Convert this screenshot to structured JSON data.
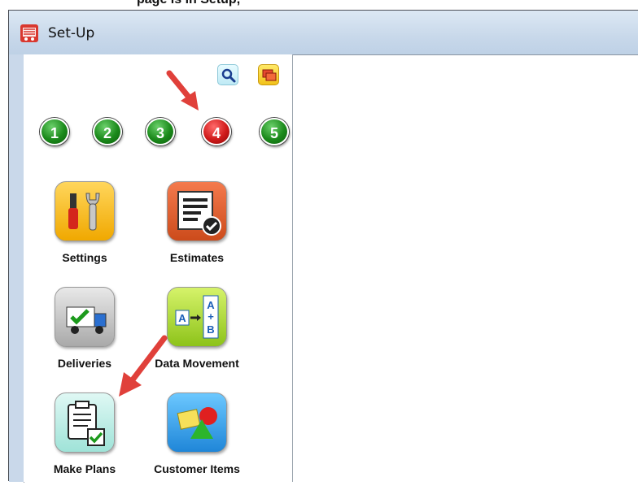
{
  "caption_fragment": "page is in Setup,",
  "window": {
    "title": "Set-Up"
  },
  "toolbar": {
    "zoom_icon": "magnifier-icon",
    "window_icon": "cascade-windows-icon"
  },
  "steps": [
    {
      "label": "1",
      "state": "inactive",
      "color": "#1b8a1b"
    },
    {
      "label": "2",
      "state": "inactive",
      "color": "#1b8a1b"
    },
    {
      "label": "3",
      "state": "inactive",
      "color": "#1b8a1b"
    },
    {
      "label": "4",
      "state": "active",
      "color": "#d01a1a"
    },
    {
      "label": "5",
      "state": "inactive",
      "color": "#1b8a1b"
    }
  ],
  "apps": [
    {
      "label": "Settings",
      "icon": "tools-icon"
    },
    {
      "label": "Estimates",
      "icon": "document-check-icon"
    },
    {
      "label": "Deliveries",
      "icon": "delivery-truck-icon"
    },
    {
      "label": "Data Movement",
      "icon": "data-movement-icon"
    },
    {
      "label": "Make Plans",
      "icon": "clipboard-check-icon"
    },
    {
      "label": "Customer Items",
      "icon": "shapes-icon"
    }
  ],
  "annotations": {
    "arrow_color": "#e0403a"
  }
}
